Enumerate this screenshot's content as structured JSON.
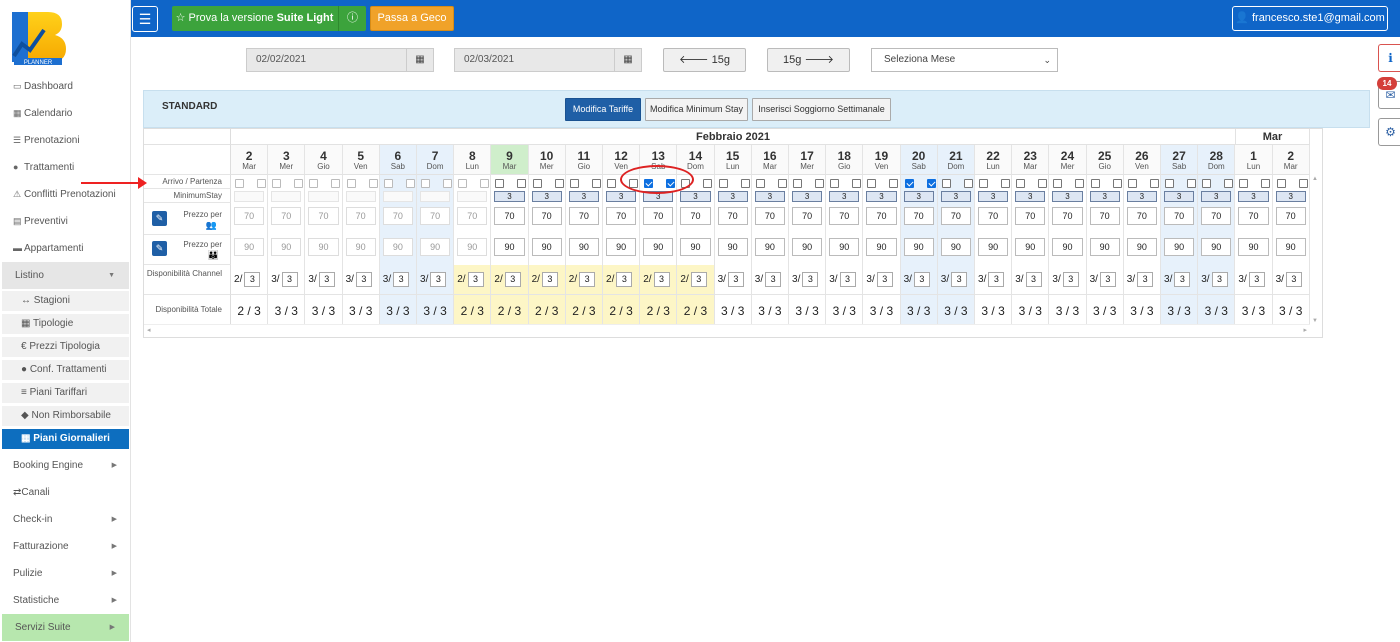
{
  "logo": {
    "letter": "B",
    "sub": "PLANNER"
  },
  "sidebar": {
    "items": [
      {
        "label": "Dashboard",
        "icon": "monitor-icon"
      },
      {
        "label": "Calendario",
        "icon": "calendar-icon"
      },
      {
        "label": "Prenotazioni",
        "icon": "list-icon"
      },
      {
        "label": "Trattamenti",
        "icon": "apple-icon"
      },
      {
        "label": "Conflitti Prenotazioni",
        "icon": "warning-icon"
      },
      {
        "label": "Preventivi",
        "icon": "calculator-icon"
      },
      {
        "label": "Appartamenti",
        "icon": "bed-icon"
      }
    ],
    "listino": "Listino",
    "sub": [
      {
        "label": "Stagioni",
        "icon": "arrows-h-icon"
      },
      {
        "label": "Tipologie",
        "icon": "grid-icon"
      },
      {
        "label": "Prezzi Tipologia",
        "icon": "euro-icon"
      },
      {
        "label": "Conf. Trattamenti",
        "icon": "apple-icon"
      },
      {
        "label": "Piani Tariffari",
        "icon": "bars-icon"
      },
      {
        "label": "Non Rimborsabile",
        "icon": "tag-icon"
      },
      {
        "label": "Piani Giornalieri",
        "icon": "grid-icon"
      }
    ],
    "bottom": [
      {
        "label": "Booking Engine",
        "arrow": true
      },
      {
        "label": "Canali",
        "arrow": false
      },
      {
        "label": "Check-in",
        "arrow": true
      },
      {
        "label": "Fatturazione",
        "arrow": true
      },
      {
        "label": "Pulizie",
        "arrow": true
      },
      {
        "label": "Statistiche",
        "arrow": true
      }
    ],
    "servizi": "Servizi Suite"
  },
  "topbar": {
    "suite_prefix": "Prova la versione ",
    "suite_bold": "Suite Light",
    "geco": "Passa a Geco",
    "user": "francesco.ste1@gmail.com"
  },
  "toolbar": {
    "date_from": "02/02/2021",
    "date_to": "02/03/2021",
    "prev": "15g",
    "next": "15g",
    "month_select": "Seleziona Mese"
  },
  "notifications": {
    "count": "14"
  },
  "panel": {
    "title": "STANDARD",
    "tabs": [
      "Modifica Tariffe",
      "Modifica Minimum Stay",
      "Inserisci Soggiorno Settimanale"
    ]
  },
  "grid": {
    "month1": "Febbraio 2021",
    "month2": "Mar",
    "labels": {
      "arrivo": "Arrivo / Partenza",
      "min_stay": "MinimumStay",
      "prezzo": "Prezzo per",
      "disp_channel": "Disponibilità Channel",
      "disp_totale": "Disponibilità Totale"
    },
    "days": [
      {
        "d": "2",
        "w": "Mar",
        "t": "w",
        "a": "2",
        "disabled": true
      },
      {
        "d": "3",
        "w": "Mer",
        "t": "w",
        "a": "3",
        "disabled": true
      },
      {
        "d": "4",
        "w": "Gio",
        "t": "w",
        "a": "3",
        "disabled": true
      },
      {
        "d": "5",
        "w": "Ven",
        "t": "w",
        "a": "3",
        "disabled": true
      },
      {
        "d": "6",
        "w": "Sab",
        "t": "b",
        "a": "3",
        "disabled": true
      },
      {
        "d": "7",
        "w": "Dom",
        "t": "b",
        "a": "3",
        "disabled": true
      },
      {
        "d": "8",
        "w": "Lun",
        "t": "y",
        "a": "2",
        "disabled": true
      },
      {
        "d": "9",
        "w": "Mar",
        "t": "y",
        "a": "2",
        "disabled": false,
        "today": true
      },
      {
        "d": "10",
        "w": "Mer",
        "t": "y",
        "a": "2",
        "disabled": false
      },
      {
        "d": "11",
        "w": "Gio",
        "t": "y",
        "a": "2",
        "disabled": false
      },
      {
        "d": "12",
        "w": "Ven",
        "t": "y",
        "a": "2",
        "disabled": false
      },
      {
        "d": "13",
        "w": "Sab",
        "t": "y",
        "a": "2",
        "disabled": false,
        "cb": [
          true,
          true
        ]
      },
      {
        "d": "14",
        "w": "Dom",
        "t": "y",
        "a": "2",
        "disabled": false
      },
      {
        "d": "15",
        "w": "Lun",
        "t": "w",
        "a": "3",
        "disabled": false
      },
      {
        "d": "16",
        "w": "Mar",
        "t": "w",
        "a": "3",
        "disabled": false
      },
      {
        "d": "17",
        "w": "Mer",
        "t": "w",
        "a": "3",
        "disabled": false
      },
      {
        "d": "18",
        "w": "Gio",
        "t": "w",
        "a": "3",
        "disabled": false
      },
      {
        "d": "19",
        "w": "Ven",
        "t": "w",
        "a": "3",
        "disabled": false
      },
      {
        "d": "20",
        "w": "Sab",
        "t": "b",
        "a": "3",
        "disabled": false,
        "cb": [
          true,
          true
        ]
      },
      {
        "d": "21",
        "w": "Dom",
        "t": "b",
        "a": "3",
        "disabled": false
      },
      {
        "d": "22",
        "w": "Lun",
        "t": "w",
        "a": "3",
        "disabled": false
      },
      {
        "d": "23",
        "w": "Mar",
        "t": "w",
        "a": "3",
        "disabled": false
      },
      {
        "d": "24",
        "w": "Mer",
        "t": "w",
        "a": "3",
        "disabled": false
      },
      {
        "d": "25",
        "w": "Gio",
        "t": "w",
        "a": "3",
        "disabled": false
      },
      {
        "d": "26",
        "w": "Ven",
        "t": "w",
        "a": "3",
        "disabled": false
      },
      {
        "d": "27",
        "w": "Sab",
        "t": "b",
        "a": "3",
        "disabled": false
      },
      {
        "d": "28",
        "w": "Dom",
        "t": "b",
        "a": "3",
        "disabled": false
      },
      {
        "d": "1",
        "w": "Lun",
        "t": "w",
        "a": "3",
        "disabled": false
      },
      {
        "d": "2",
        "w": "Mar",
        "t": "w",
        "a": "3",
        "disabled": false
      }
    ],
    "min_stay": "3",
    "price2": "70",
    "price3": "90",
    "total_of": "3"
  }
}
